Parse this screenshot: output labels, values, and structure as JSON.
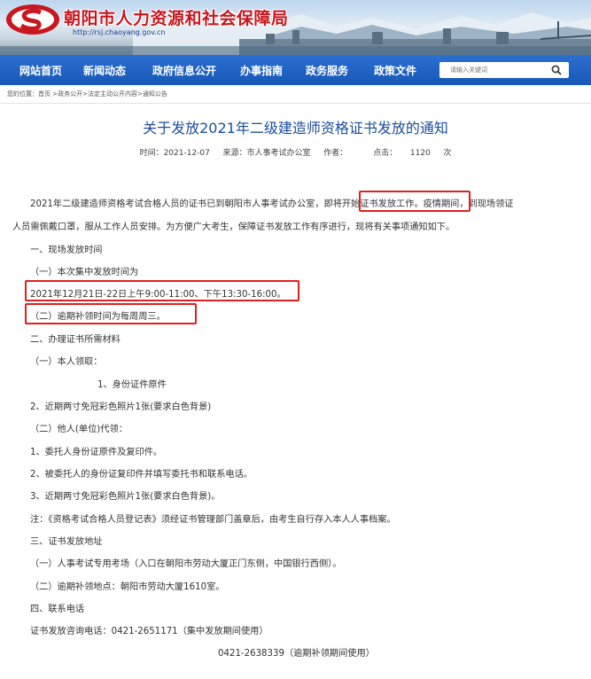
{
  "header": {
    "site_title": "朝阳市人力资源和社会保障局",
    "site_url": "http://rsj.chaoyang.gov.cn"
  },
  "nav": {
    "items": [
      "网站首页",
      "新闻动态",
      "政府信息公开",
      "办事指南",
      "政务服务",
      "政策文件"
    ],
    "search_placeholder": "请输入关键词"
  },
  "breadcrumb": "您的位置：首页 >政务公开>法定主动公开内容>通知公告",
  "article": {
    "title": "关于发放2021年二级建造师资格证书发放的通知",
    "time_label": "时间：",
    "time": "2021-12-07",
    "source_label": "来源：",
    "source": "市人事考试办公室",
    "author_label": "作者：",
    "clicks_label": "点击：",
    "clicks": "1120",
    "clicks_unit": "次"
  },
  "body": {
    "p1a": "2021年二级建造师资格考试合格人员的证书已到朝阳市人事考试办公室，",
    "p1b": "即将开始证书发放工作",
    "p1c": "。疫情期间，到现场领证",
    "p1d": "人员需佩戴口罩，服从工作人员安排。为方便广大考生，保障证书发放工作有序进行，现将有关事项通知如下。",
    "s1": "一、现场发放时间",
    "s1_1": "（一）本次集中发放时间为",
    "s1_1_time": "2021年12月21日-22日上午9:00-11:00、下午13:30-16:00。",
    "s1_2": "（二）逾期补领时间为每周周三。",
    "s2": "二、办理证书所需材料",
    "s2_1": "（一）本人领取：",
    "s2_1_a": "1、身份证件原件",
    "s2_1_b": "2、近期两寸免冠彩色照片1张(要求白色背景)",
    "s2_2": "（二）他人(单位)代领：",
    "s2_2_a": "1、委托人身份证原件及复印件。",
    "s2_2_b": "2、被委托人的身份证复印件并填写委托书和联系电话。",
    "s2_2_c": "3、近期两寸免冠彩色照片1张(要求白色背景)。",
    "note": "注：《资格考试合格人员登记表》须经证书管理部门盖章后，由考生自行存入本人人事档案。",
    "s3": "三、证书发放地址",
    "s3_1": "（一）人事考试专用考场（入口在朝阳市劳动大厦正门东侧，中国银行西侧）。",
    "s3_2": "（二）逾期补领地点：朝阳市劳动大厦1610室。",
    "s4": "四、联系电话",
    "phone1": "证书发放咨询电话：0421-2651171（集中发放期间使用）",
    "phone2": "0421-2638339（逾期补领期间使用）"
  },
  "colors": {
    "nav_bg": "#1f63c4",
    "title_blue": "#1c4d9c",
    "highlight_red": "#e02020",
    "site_title_red": "#c8171e"
  }
}
